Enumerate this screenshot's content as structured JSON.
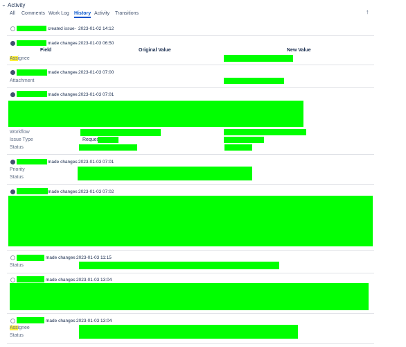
{
  "section_title": "Activity",
  "tabs": [
    "All",
    "Comments",
    "Work Log",
    "History",
    "Activity",
    "Transitions"
  ],
  "active_tab": "History",
  "sort_icon": "arrow-up-icon",
  "columns": {
    "field": "Field",
    "original": "Original Value",
    "new": "New Value"
  },
  "entries": [
    {
      "action": "created issue",
      "timestamp": "2023-01-02 14:12"
    },
    {
      "action": "made changes",
      "timestamp": "2023-01-03 06:50",
      "fields": {
        "a": "Ass",
        "b": "ignee"
      }
    },
    {
      "action": "made changes",
      "timestamp": "2023-01-03 07:00",
      "fields": [
        "Attachment"
      ]
    },
    {
      "action": "made changes",
      "timestamp": "2023-01-03 07:01",
      "fields": [
        "Workflow",
        "Issue Type",
        "Status"
      ],
      "original_value_text": "Request"
    },
    {
      "action": "made changes",
      "timestamp": "2023-01-03 07:01",
      "fields": [
        "Priority",
        "Status"
      ]
    },
    {
      "action": "made changes",
      "timestamp": "2023-01-03 07:02"
    },
    {
      "action": "made changes",
      "timestamp": "2023-01-03 11:15",
      "fields": [
        "Status"
      ]
    },
    {
      "action": "made changes",
      "timestamp": "2023-01-03 13:04"
    },
    {
      "action": "made changes",
      "timestamp": "2023-01-03 13:04",
      "fields": {
        "a": "Ass",
        "b": "ignee",
        "c": "Status"
      }
    }
  ],
  "colors": {
    "accent": "#0052cc",
    "redaction": "#00ff00",
    "highlight": "#ffef3b",
    "divider": "#dfe1e6"
  }
}
